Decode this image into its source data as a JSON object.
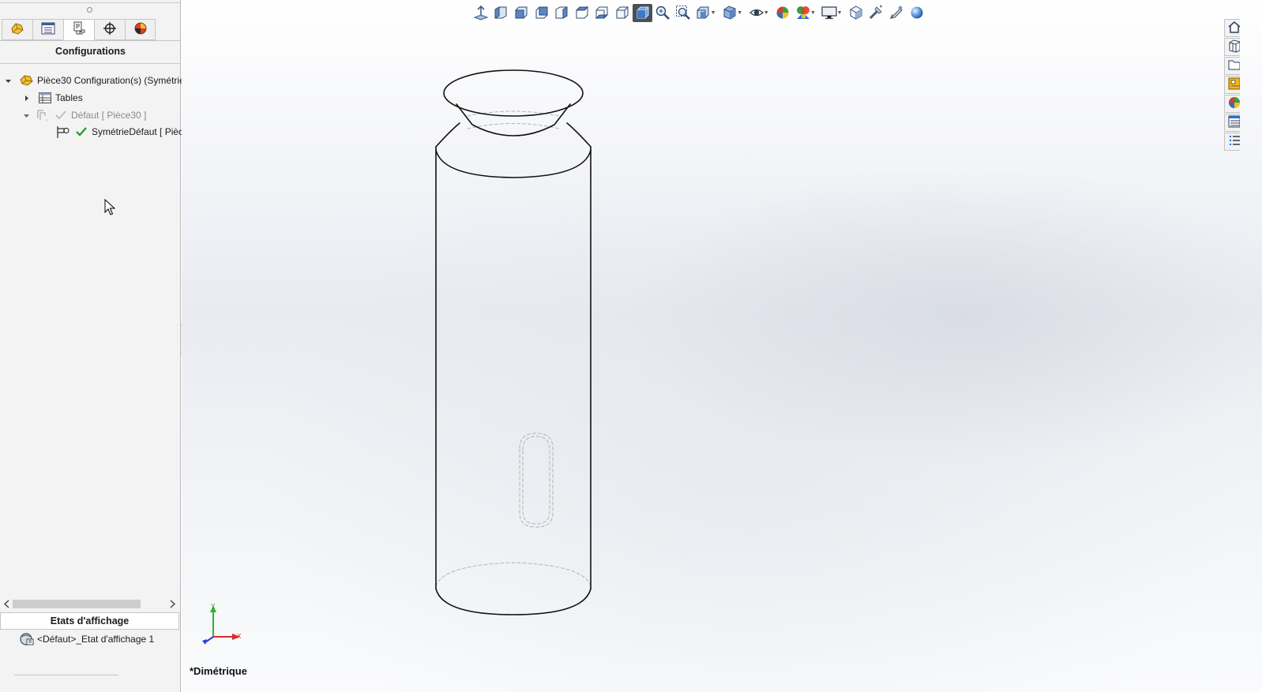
{
  "feature_manager": {
    "tabs": [
      {
        "name": "featuremanager-tab",
        "icon": "part-feature-tree-icon"
      },
      {
        "name": "propertymanager-tab",
        "icon": "property-manager-icon"
      },
      {
        "name": "configurationmanager-tab",
        "icon": "configuration-manager-icon"
      },
      {
        "name": "dimxpertmanager-tab",
        "icon": "dimxpert-target-icon"
      },
      {
        "name": "displaymanager-tab",
        "icon": "display-manager-icon"
      }
    ],
    "active_tab": 2,
    "title": "Configurations",
    "tree": {
      "root_label": "Pièce30 Configuration(s)  (Symétrie",
      "tables_label": "Tables",
      "default_config_label": "Défaut [ Pièce30 ]",
      "derived_config_label": "SymétrieDéfaut [ Pièce"
    },
    "display_states": {
      "title": "Etats d'affichage",
      "item_label": "<Défaut>_Etat d'affichage 1"
    }
  },
  "viewport": {
    "view_orientation": "*Dimétrique",
    "triad": {
      "x_label": "X",
      "y_label": "Y"
    },
    "heads_up_toolbar": [
      {
        "name": "normal-to-icon"
      },
      {
        "name": "view-left-icon"
      },
      {
        "name": "view-front-icon"
      },
      {
        "name": "view-back-icon"
      },
      {
        "name": "view-right-icon"
      },
      {
        "name": "view-top-icon"
      },
      {
        "name": "view-bottom-icon"
      },
      {
        "name": "view-isometric-icon"
      },
      {
        "name": "view-dimetric-icon",
        "active": true
      },
      {
        "name": "zoom-to-fit-icon"
      },
      {
        "name": "zoom-to-area-icon"
      },
      {
        "name": "section-view-icon",
        "dropdown": true
      },
      {
        "name": "display-style-icon",
        "dropdown": true
      },
      {
        "name": "hide-show-items-icon",
        "dropdown": true
      },
      {
        "name": "edit-appearance-icon"
      },
      {
        "name": "apply-scene-icon",
        "dropdown": true
      },
      {
        "name": "view-settings-icon",
        "dropdown": true
      },
      {
        "name": "cube-view-icon"
      },
      {
        "name": "rebuild-icon"
      },
      {
        "name": "sketch-tools-icon"
      },
      {
        "name": "realview-sphere-icon"
      }
    ],
    "task_pane_tabs": [
      "solidworks-resources-icon",
      "design-library-icon",
      "file-explorer-icon",
      "view-palette-icon",
      "appearances-scenes-icon",
      "custom-properties-icon",
      "task-list-icon"
    ]
  },
  "colors": {
    "panel_bg": "#f3f3f3",
    "active_toolbar_bg": "#4a4f58",
    "check_green": "#1d9a25",
    "config_yellow": "#e9b521",
    "model_edge": "#111111",
    "hidden_edge": "#b3b3b3"
  }
}
